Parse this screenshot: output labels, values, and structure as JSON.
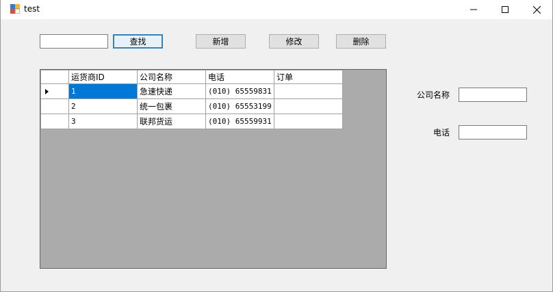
{
  "window": {
    "title": "test",
    "minimize_icon": "minimize-icon",
    "maximize_icon": "maximize-icon",
    "close_icon": "close-icon"
  },
  "toolbar": {
    "search_value": "",
    "search_label": "查找",
    "add_label": "新增",
    "edit_label": "修改",
    "delete_label": "删除"
  },
  "grid": {
    "columns": [
      "运货商ID",
      "公司名称",
      "电话",
      "订单"
    ],
    "rows": [
      {
        "id": "1",
        "company": "急速快递",
        "phone": "(010) 65559831",
        "orders": ""
      },
      {
        "id": "2",
        "company": "统一包裹",
        "phone": "(010) 65553199",
        "orders": ""
      },
      {
        "id": "3",
        "company": "联邦货运",
        "phone": "(010) 65559931",
        "orders": ""
      }
    ],
    "selected_row": 0
  },
  "form": {
    "company_label": "公司名称",
    "company_value": "",
    "phone_label": "电话",
    "phone_value": ""
  },
  "colors": {
    "selection": "#0078d7",
    "grid_background": "#ababab",
    "focus_border": "#3c7fb1"
  }
}
